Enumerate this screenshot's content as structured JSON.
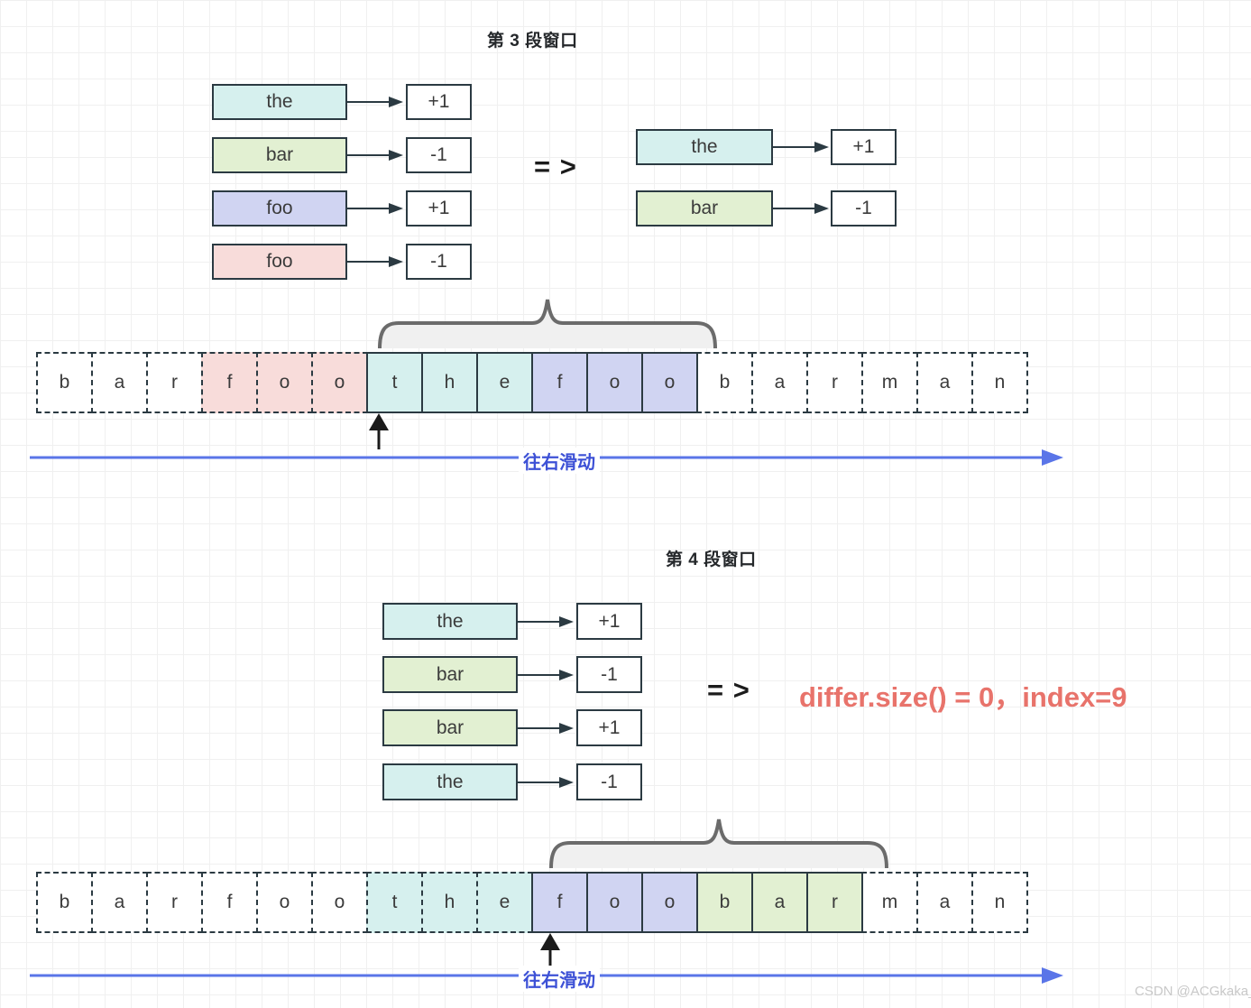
{
  "watermark": "CSDN @ACGkaka_",
  "sections": [
    {
      "title": "第 3 段窗口",
      "arrow_symbol": "= >",
      "left_pairs": [
        {
          "word": "the",
          "color": "cyan",
          "value": "+1"
        },
        {
          "word": "bar",
          "color": "green",
          "value": "-1"
        },
        {
          "word": "foo",
          "color": "purple",
          "value": "+1"
        },
        {
          "word": "foo",
          "color": "pink",
          "value": "-1"
        }
      ],
      "right_pairs": [
        {
          "word": "the",
          "color": "cyan",
          "value": "+1"
        },
        {
          "word": "bar",
          "color": "green",
          "value": "-1"
        }
      ],
      "strip": [
        {
          "ch": "b",
          "color": "white",
          "border": "dashed"
        },
        {
          "ch": "a",
          "color": "white",
          "border": "dashed"
        },
        {
          "ch": "r",
          "color": "white",
          "border": "dashed"
        },
        {
          "ch": "f",
          "color": "pink",
          "border": "dashed"
        },
        {
          "ch": "o",
          "color": "pink",
          "border": "dashed"
        },
        {
          "ch": "o",
          "color": "pink",
          "border": "dashed"
        },
        {
          "ch": "t",
          "color": "cyan",
          "border": "solid"
        },
        {
          "ch": "h",
          "color": "cyan",
          "border": "solid"
        },
        {
          "ch": "e",
          "color": "cyan",
          "border": "solid"
        },
        {
          "ch": "f",
          "color": "purple",
          "border": "solid"
        },
        {
          "ch": "o",
          "color": "purple",
          "border": "solid"
        },
        {
          "ch": "o",
          "color": "purple",
          "border": "solid"
        },
        {
          "ch": "b",
          "color": "white",
          "border": "dashed"
        },
        {
          "ch": "a",
          "color": "white",
          "border": "dashed"
        },
        {
          "ch": "r",
          "color": "white",
          "border": "dashed"
        },
        {
          "ch": "m",
          "color": "white",
          "border": "dashed"
        },
        {
          "ch": "a",
          "color": "white",
          "border": "dashed"
        },
        {
          "ch": "n",
          "color": "white",
          "border": "dashed"
        }
      ],
      "slide_label": "往右滑动"
    },
    {
      "title": "第 4 段窗口",
      "arrow_symbol": "= >",
      "left_pairs": [
        {
          "word": "the",
          "color": "cyan",
          "value": "+1"
        },
        {
          "word": "bar",
          "color": "green",
          "value": "-1"
        },
        {
          "word": "bar",
          "color": "green",
          "value": "+1"
        },
        {
          "word": "the",
          "color": "cyan",
          "value": "-1"
        }
      ],
      "result": "differ.size() = 0，index=9",
      "strip": [
        {
          "ch": "b",
          "color": "white",
          "border": "dashed"
        },
        {
          "ch": "a",
          "color": "white",
          "border": "dashed"
        },
        {
          "ch": "r",
          "color": "white",
          "border": "dashed"
        },
        {
          "ch": "f",
          "color": "white",
          "border": "dashed"
        },
        {
          "ch": "o",
          "color": "white",
          "border": "dashed"
        },
        {
          "ch": "o",
          "color": "white",
          "border": "dashed"
        },
        {
          "ch": "t",
          "color": "cyan",
          "border": "dashed"
        },
        {
          "ch": "h",
          "color": "cyan",
          "border": "dashed"
        },
        {
          "ch": "e",
          "color": "cyan",
          "border": "dashed"
        },
        {
          "ch": "f",
          "color": "purple",
          "border": "solid"
        },
        {
          "ch": "o",
          "color": "purple",
          "border": "solid"
        },
        {
          "ch": "o",
          "color": "purple",
          "border": "solid"
        },
        {
          "ch": "b",
          "color": "green",
          "border": "solid"
        },
        {
          "ch": "a",
          "color": "green",
          "border": "solid"
        },
        {
          "ch": "r",
          "color": "green",
          "border": "solid"
        },
        {
          "ch": "m",
          "color": "white",
          "border": "dashed"
        },
        {
          "ch": "a",
          "color": "white",
          "border": "dashed"
        },
        {
          "ch": "n",
          "color": "white",
          "border": "dashed"
        }
      ],
      "slide_label": "往右滑动"
    }
  ],
  "colors": {
    "cyan": "#d6f0ee",
    "green": "#e2f0d2",
    "purple": "#d0d4f2",
    "pink": "#f8dcda",
    "result_red": "#e8736b",
    "slide_blue": "#5a75e8",
    "slide_text": "#3d51d6",
    "box_border": "#2b3a42",
    "brace_gray": "#6b6b6b"
  }
}
